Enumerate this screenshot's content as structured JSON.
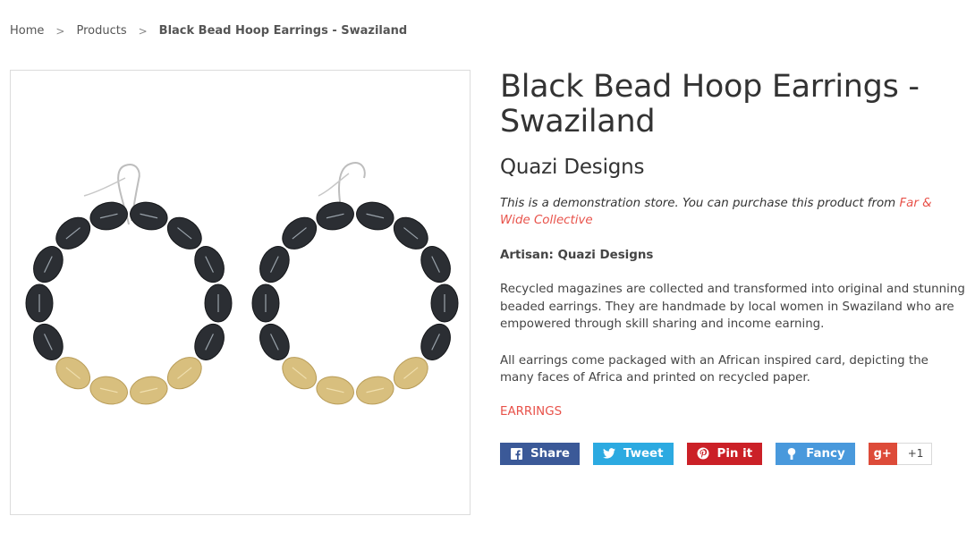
{
  "breadcrumb": {
    "home": "Home",
    "separator": ">",
    "products": "Products",
    "current": "Black Bead Hoop Earrings - Swaziland"
  },
  "product": {
    "title": "Black Bead Hoop Earrings - Swaziland",
    "vendor": "Quazi Designs",
    "demo_text": "This is a demonstration store. You can purchase this product from ",
    "demo_link": "Far & Wide Collective",
    "artisan": "Artisan: Quazi Designs",
    "description_1": "Recycled magazines are collected and transformed into original and stunning beaded earrings. They are handmade by local women in Swaziland who are empowered through skill sharing and income earning.",
    "description_2": "All earrings come packaged with an African inspired card, depicting the many faces of Africa and printed on recycled paper.",
    "tag": "EARRINGS",
    "image_alt": "black-bead-hoop-earrings-photo"
  },
  "share": {
    "facebook": "Share",
    "twitter": "Tweet",
    "pinterest": "Pin it",
    "fancy": "Fancy",
    "gplus_icon": "g+",
    "gplus_count": "+1"
  },
  "colors": {
    "link": "#e8524a",
    "facebook": "#3b5998",
    "twitter": "#2caae1",
    "pinterest": "#cb2027",
    "fancy": "#4999dc",
    "gplus": "#dd4b39"
  },
  "icons": {
    "facebook": "facebook-icon",
    "twitter": "twitter-icon",
    "pinterest": "pinterest-icon",
    "fancy": "fancy-icon",
    "gplus": "google-plus-icon"
  }
}
